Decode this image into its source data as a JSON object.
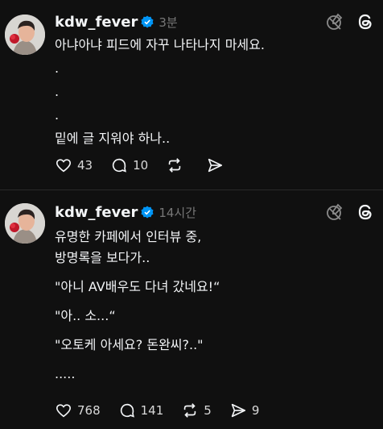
{
  "posts": [
    {
      "username": "kdw_fever",
      "time": "3분",
      "lines": [
        "아냐아냐 피드에 자꾸 나타나지 마세요.",
        ".",
        ".",
        ".",
        "밑에 글 지워야 하나.."
      ],
      "actions": {
        "likes": "43",
        "replies": "10",
        "reposts": "",
        "shares": ""
      }
    },
    {
      "username": "kdw_fever",
      "time": "14시간",
      "paragraphs": [
        [
          "유명한 카페에서 인터뷰 중,",
          "방명록을 보다가.."
        ],
        [
          "\"아니 AV배우도 다녀 갔네요!“"
        ],
        [
          "\"아.. 소...“"
        ],
        [
          "\"오토케 아세요? 돈완씨?..\""
        ],
        [
          "....."
        ]
      ],
      "actions": {
        "likes": "768",
        "replies": "141",
        "reposts": "5",
        "shares": "9"
      }
    }
  ],
  "colors": {
    "background": "#101010",
    "text": "#f3f5f7",
    "muted": "#777777",
    "verified": "#0095f6"
  }
}
